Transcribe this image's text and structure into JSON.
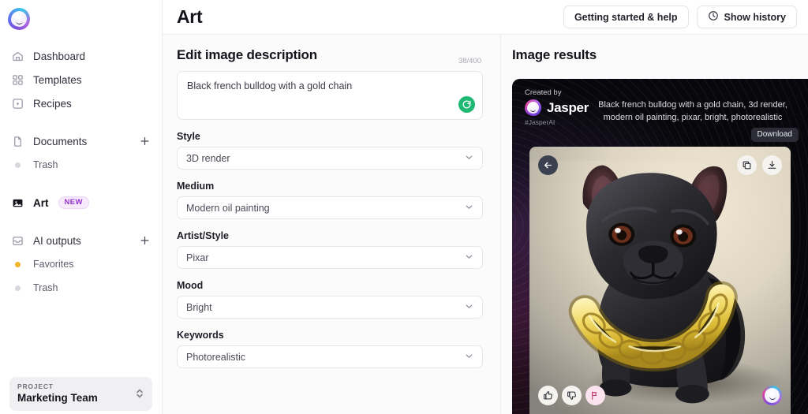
{
  "app": {
    "logo_icon": "jasper-blob-logo"
  },
  "sidebar": {
    "items": [
      {
        "label": "Dashboard",
        "icon": "home-icon",
        "kind": "primary"
      },
      {
        "label": "Templates",
        "icon": "grid-icon",
        "kind": "primary"
      },
      {
        "label": "Recipes",
        "icon": "play-square-icon",
        "kind": "primary"
      },
      {
        "label": "Documents",
        "icon": "document-icon",
        "kind": "primary",
        "action": "+"
      },
      {
        "label": "Trash",
        "icon": "dot-icon",
        "kind": "muted"
      },
      {
        "label": "Art",
        "icon": "image-icon",
        "kind": "active",
        "badge": "NEW"
      },
      {
        "label": "AI outputs",
        "icon": "inbox-icon",
        "kind": "primary",
        "action": "+"
      },
      {
        "label": "Favorites",
        "icon": "dot-gold-icon",
        "kind": "muted"
      },
      {
        "label": "Trash",
        "icon": "dot-icon",
        "kind": "muted"
      }
    ],
    "project": {
      "caption": "PROJECT",
      "name": "Marketing Team"
    }
  },
  "header": {
    "title": "Art",
    "getting_started_label": "Getting started & help",
    "show_history_label": "Show history",
    "history_icon": "clock-icon"
  },
  "editor": {
    "section_title": "Edit image description",
    "char_count": "38/400",
    "description": "Black french bulldog with a gold chain",
    "refresh_icon": "refresh-icon",
    "fields": [
      {
        "label": "Style",
        "value": "3D render"
      },
      {
        "label": "Medium",
        "value": "Modern oil painting"
      },
      {
        "label": "Artist/Style",
        "value": "Pixar"
      },
      {
        "label": "Mood",
        "value": "Bright"
      },
      {
        "label": "Keywords",
        "value": "Photorealistic"
      }
    ]
  },
  "results": {
    "section_title": "Image results",
    "created_by_label": "Created by",
    "brand_name": "Jasper",
    "brand_tag": "#JasperAI",
    "prompt_echo": "Black french bulldog with a gold chain, 3d render, modern oil painting, pixar, bright, photorealistic",
    "tooltip": "Download",
    "controls": {
      "back_icon": "arrow-left-icon",
      "copy_icon": "copy-icon",
      "download_icon": "download-icon",
      "thumbs_up_icon": "thumbs-up-icon",
      "thumbs_down_icon": "thumbs-down-icon",
      "flag_icon": "flag-icon",
      "watermark_icon": "jasper-blob-logo"
    }
  },
  "colors": {
    "accent_green": "#1fb873",
    "badge_purple": "#9333c6",
    "favorite_gold": "#f0b429",
    "flag_pink": "#c03a6e",
    "card_black": "#08080c"
  }
}
